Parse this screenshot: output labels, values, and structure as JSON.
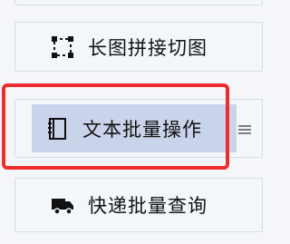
{
  "menu": {
    "items": [
      {
        "label": "长图拼接切图",
        "icon": "crop-frame-icon"
      },
      {
        "label": "文本批量操作",
        "icon": "notebook-icon",
        "selected": true
      },
      {
        "label": "快递批量查询",
        "icon": "truck-icon"
      }
    ]
  },
  "colors": {
    "highlight_border": "#ef2b2d",
    "selected_bg": "#c9d3ea",
    "item_bg": "#f3f6fb",
    "text": "#111111"
  }
}
